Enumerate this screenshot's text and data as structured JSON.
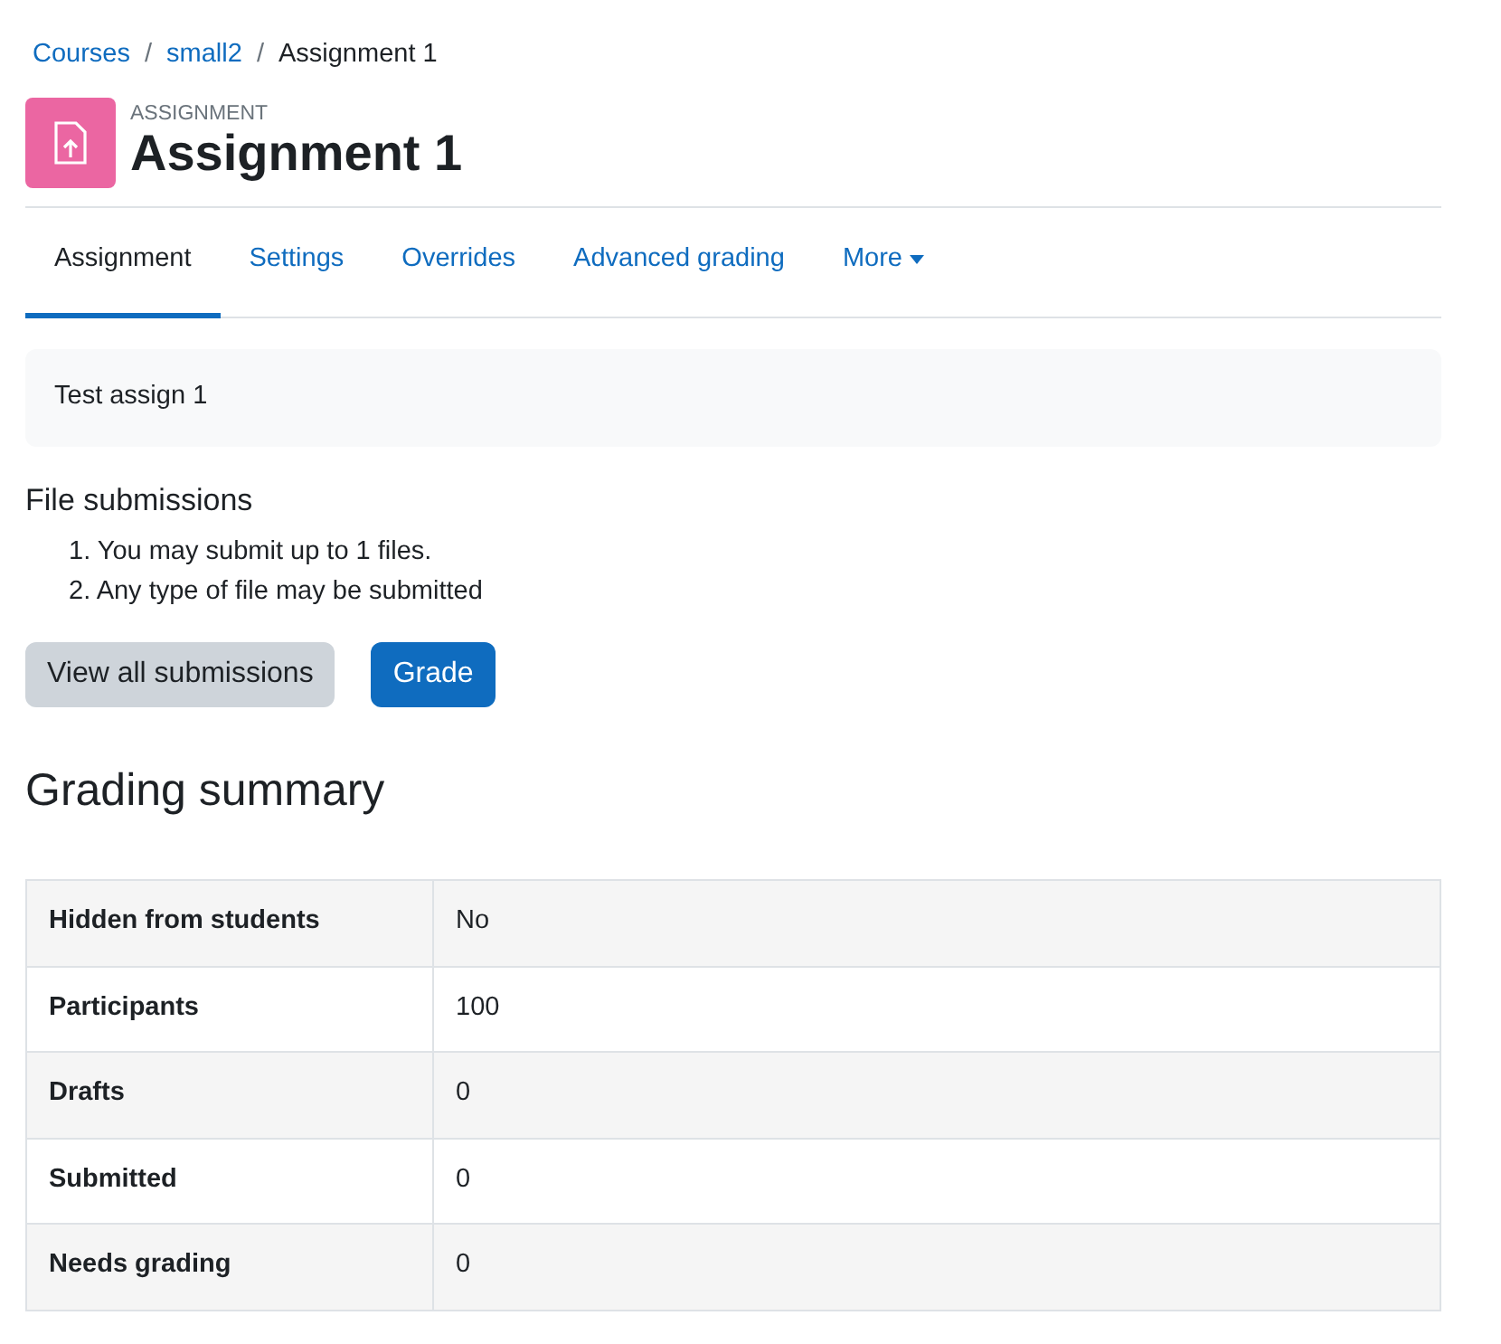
{
  "breadcrumb_separator": "/",
  "breadcrumb": [
    {
      "label": "Courses",
      "link": true
    },
    {
      "label": "small2",
      "link": true
    },
    {
      "label": "Assignment 1",
      "link": false
    }
  ],
  "header": {
    "kind_label": "ASSIGNMENT",
    "title": "Assignment 1"
  },
  "tabs": [
    {
      "label": "Assignment",
      "selected": true,
      "dropdown": false
    },
    {
      "label": "Settings",
      "selected": false,
      "dropdown": false
    },
    {
      "label": "Overrides",
      "selected": false,
      "dropdown": false
    },
    {
      "label": "Advanced grading",
      "selected": false,
      "dropdown": false
    },
    {
      "label": "More",
      "selected": false,
      "dropdown": true
    }
  ],
  "intro": "Test assign 1",
  "file_submissions": {
    "heading": "File submissions",
    "items": [
      {
        "number": "1.",
        "text": "You may submit up to 1 files."
      },
      {
        "number": "2.",
        "text": "Any type of file may be submitted"
      }
    ]
  },
  "buttons": [
    {
      "label": "View all submissions",
      "kind": "secondary"
    },
    {
      "label": "Grade",
      "kind": "primary"
    }
  ],
  "grading_summary": {
    "heading": "Grading summary",
    "rows": [
      {
        "label": "Hidden from students",
        "value": "No"
      },
      {
        "label": "Participants",
        "value": "100"
      },
      {
        "label": "Drafts",
        "value": "0"
      },
      {
        "label": "Submitted",
        "value": "0"
      },
      {
        "label": "Needs grading",
        "value": "0"
      }
    ]
  }
}
